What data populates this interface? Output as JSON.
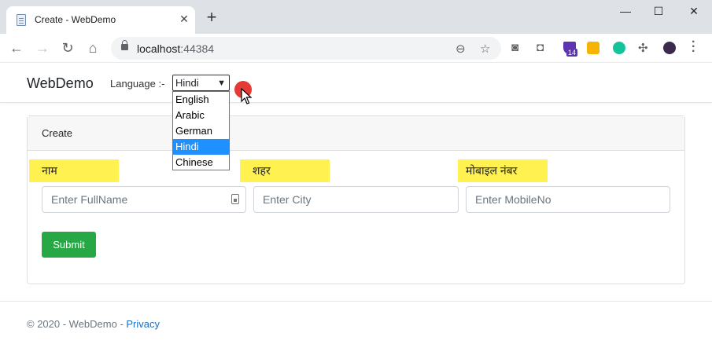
{
  "browser": {
    "tab_title": "Create - WebDemo",
    "tab_close": "✕",
    "new_tab": "+",
    "window_controls": [
      "—",
      "☐",
      "✕"
    ],
    "url_host": "localhost",
    "url_port": ":44384",
    "extension_badge": "14"
  },
  "navbar": {
    "brand": "WebDemo",
    "language_label": "Language :-",
    "language_selected": "Hindi",
    "language_options": [
      "English",
      "Arabic",
      "German",
      "Hindi",
      "Chinese"
    ],
    "selected_index": 3
  },
  "form": {
    "header": "Create",
    "name_label": "नाम",
    "city_label": "शहर",
    "mobile_label": "मोबाइल नंबर",
    "name_placeholder": "Enter FullName",
    "city_placeholder": "Enter City",
    "mobile_placeholder": "Enter MobileNo",
    "submit_label": "Submit"
  },
  "footer": {
    "copyright": "© 2020 - WebDemo - ",
    "privacy_link": "Privacy"
  },
  "colors": {
    "highlight": "#fff14f",
    "submit": "#28a745",
    "link": "#1b6ec2",
    "selected_option": "#1e90ff",
    "click_indicator": "#e53935"
  }
}
